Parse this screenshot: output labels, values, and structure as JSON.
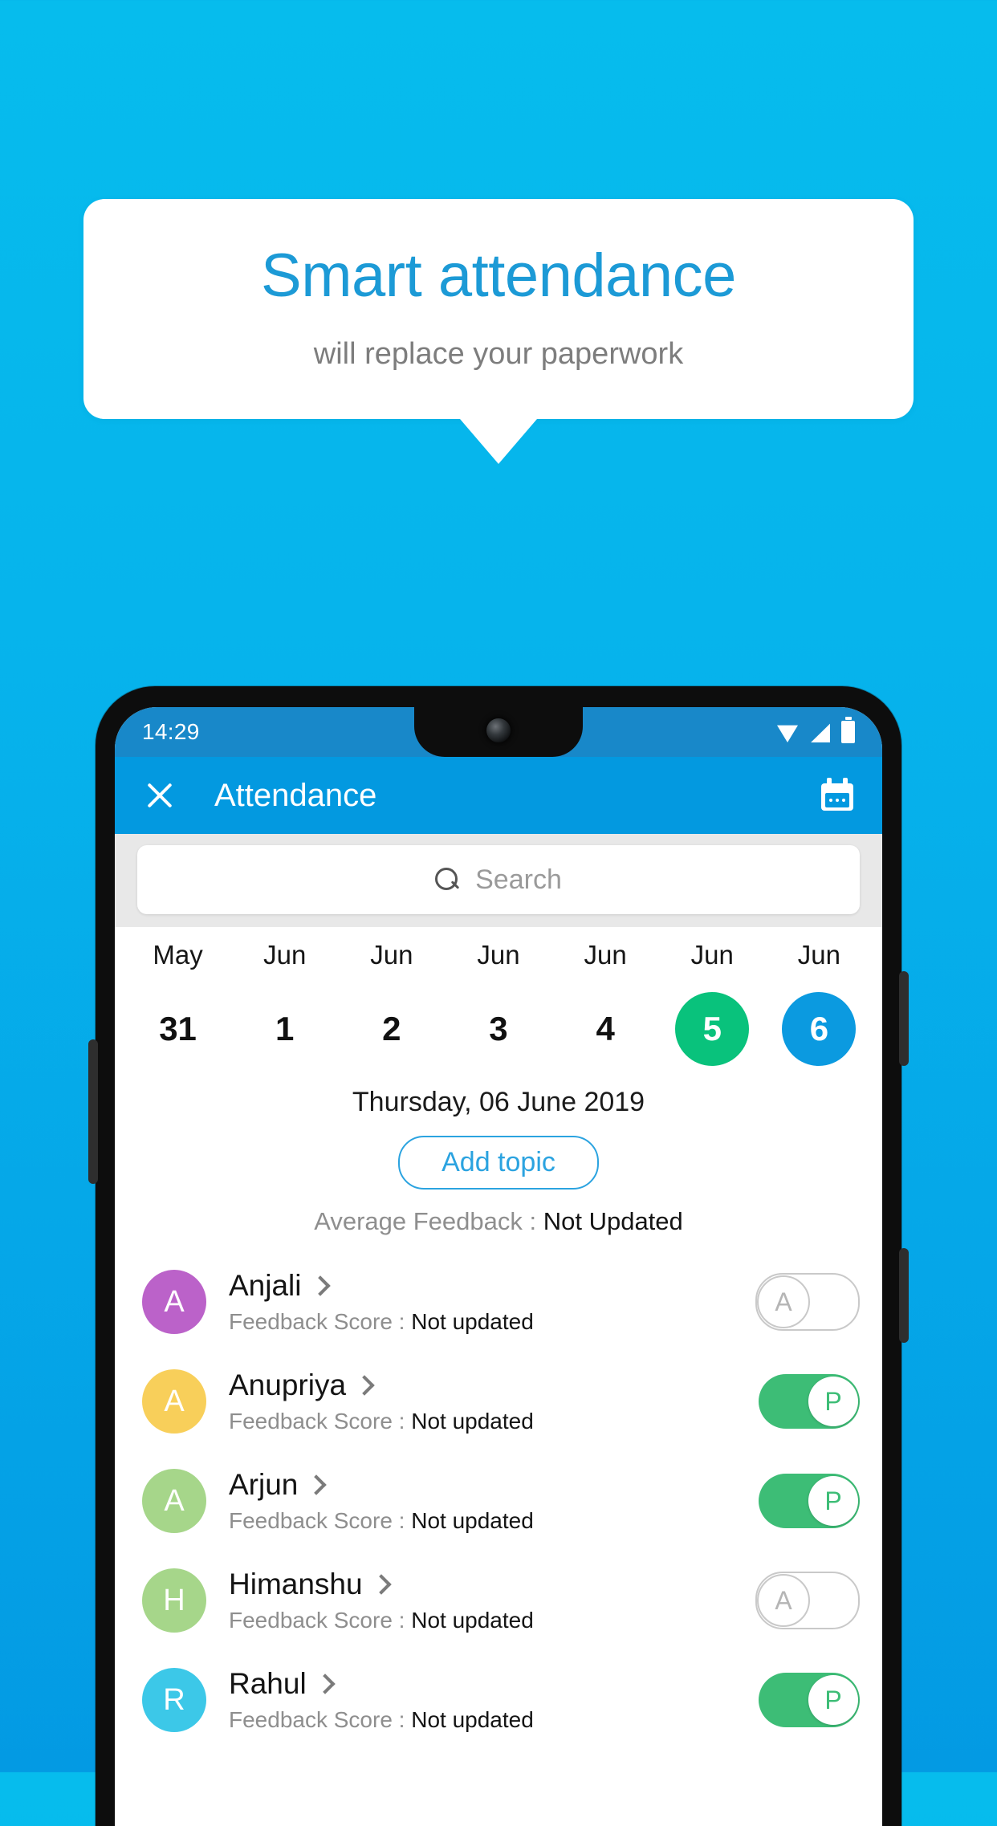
{
  "promo": {
    "title": "Smart attendance",
    "subtitle": "will replace your paperwork"
  },
  "colors": {
    "background": "#06b4ec",
    "appbar": "#0399e0",
    "statusbar": "#1888c9",
    "accent_blue": "#2ba3e0",
    "present_green": "#3dbd76",
    "today_green": "#09c27c",
    "selected_blue": "#0b9ae0"
  },
  "phone": {
    "status": {
      "time": "14:29",
      "icons": [
        "wifi-icon",
        "signal-icon",
        "battery-icon"
      ]
    },
    "appbar": {
      "close_icon": "close-icon",
      "title": "Attendance",
      "calendar_icon": "calendar-icon"
    },
    "search": {
      "icon": "search-icon",
      "placeholder": "Search",
      "value": ""
    },
    "date_strip": [
      {
        "month": "May",
        "day": "31",
        "state": "normal"
      },
      {
        "month": "Jun",
        "day": "1",
        "state": "normal"
      },
      {
        "month": "Jun",
        "day": "2",
        "state": "normal"
      },
      {
        "month": "Jun",
        "day": "3",
        "state": "normal"
      },
      {
        "month": "Jun",
        "day": "4",
        "state": "normal"
      },
      {
        "month": "Jun",
        "day": "5",
        "state": "today"
      },
      {
        "month": "Jun",
        "day": "6",
        "state": "selected"
      }
    ],
    "selected_date_label": "Thursday, 06 June 2019",
    "add_topic_label": "Add topic",
    "average_feedback": {
      "label": "Average Feedback : ",
      "value": "Not Updated"
    },
    "feedback_label": "Feedback Score : ",
    "students": [
      {
        "name": "Anjali",
        "initial": "A",
        "avatar_color": "#bb62c9",
        "feedback": "Not updated",
        "attendance": "A",
        "present": false
      },
      {
        "name": "Anupriya",
        "initial": "A",
        "avatar_color": "#f8cf5a",
        "feedback": "Not updated",
        "attendance": "P",
        "present": true
      },
      {
        "name": "Arjun",
        "initial": "A",
        "avatar_color": "#a6d68a",
        "feedback": "Not updated",
        "attendance": "P",
        "present": true
      },
      {
        "name": "Himanshu",
        "initial": "H",
        "avatar_color": "#a6d68a",
        "feedback": "Not updated",
        "attendance": "A",
        "present": false
      },
      {
        "name": "Rahul",
        "initial": "R",
        "avatar_color": "#3cc8e8",
        "feedback": "Not updated",
        "attendance": "P",
        "present": true
      }
    ]
  }
}
